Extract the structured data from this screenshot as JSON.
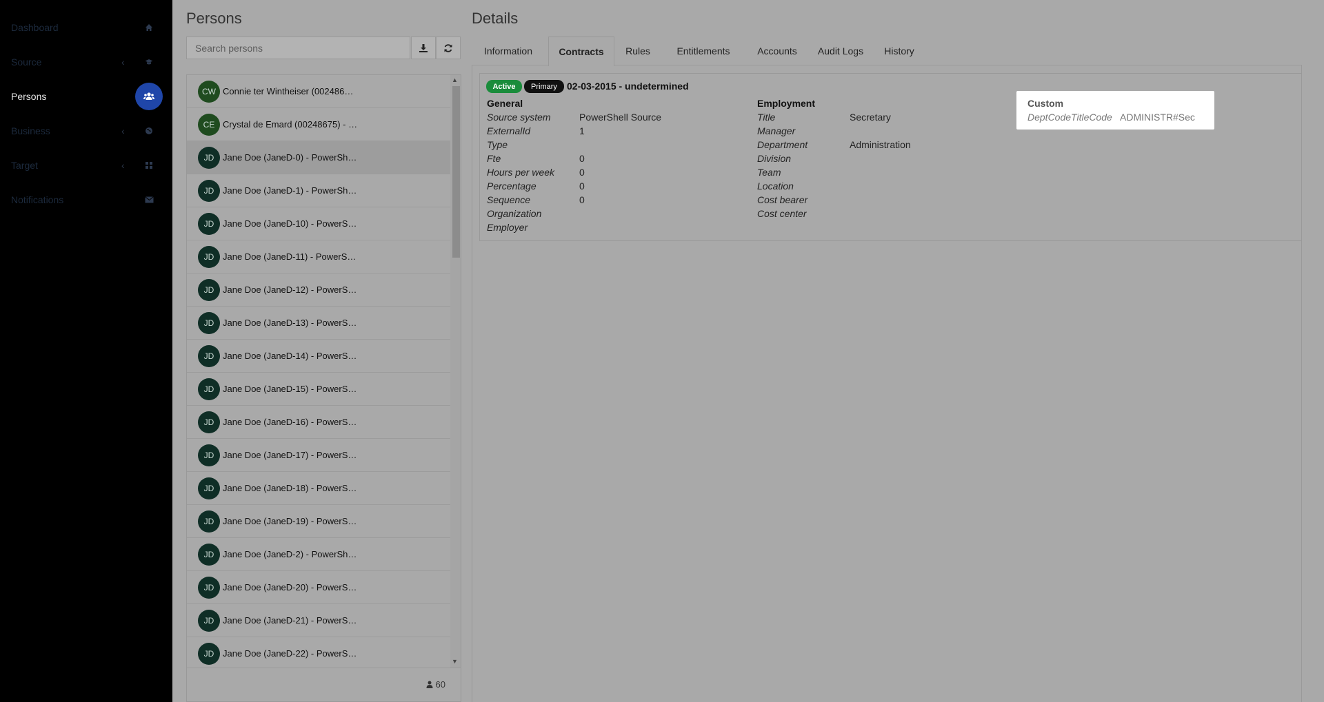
{
  "sidebar": {
    "items": [
      {
        "label": "Dashboard",
        "icon": "home-icon"
      },
      {
        "label": "Source",
        "icon": "graduation-cap-icon"
      },
      {
        "label": "Persons",
        "icon": "users-icon"
      },
      {
        "label": "Business",
        "icon": "globe-icon"
      },
      {
        "label": "Target",
        "icon": "grid-icon"
      },
      {
        "label": "Notifications",
        "icon": "envelope-icon"
      }
    ],
    "chevron": "‹"
  },
  "persons": {
    "title": "Persons",
    "search_placeholder": "Search persons",
    "rows": [
      {
        "initials": "CW",
        "name": "Connie ter Wintheiser (002486…"
      },
      {
        "initials": "CE",
        "name": "Crystal de Emard (00248675) - …"
      },
      {
        "initials": "JD",
        "name": "Jane Doe (JaneD-0) - PowerSh…"
      },
      {
        "initials": "JD",
        "name": "Jane Doe (JaneD-1) - PowerSh…"
      },
      {
        "initials": "JD",
        "name": "Jane Doe (JaneD-10) - PowerS…"
      },
      {
        "initials": "JD",
        "name": "Jane Doe (JaneD-11) - PowerS…"
      },
      {
        "initials": "JD",
        "name": "Jane Doe (JaneD-12) - PowerS…"
      },
      {
        "initials": "JD",
        "name": "Jane Doe (JaneD-13) - PowerS…"
      },
      {
        "initials": "JD",
        "name": "Jane Doe (JaneD-14) - PowerS…"
      },
      {
        "initials": "JD",
        "name": "Jane Doe (JaneD-15) - PowerS…"
      },
      {
        "initials": "JD",
        "name": "Jane Doe (JaneD-16) - PowerS…"
      },
      {
        "initials": "JD",
        "name": "Jane Doe (JaneD-17) - PowerS…"
      },
      {
        "initials": "JD",
        "name": "Jane Doe (JaneD-18) - PowerS…"
      },
      {
        "initials": "JD",
        "name": "Jane Doe (JaneD-19) - PowerS…"
      },
      {
        "initials": "JD",
        "name": "Jane Doe (JaneD-2) - PowerSh…"
      },
      {
        "initials": "JD",
        "name": "Jane Doe (JaneD-20) - PowerS…"
      },
      {
        "initials": "JD",
        "name": "Jane Doe (JaneD-21) - PowerS…"
      },
      {
        "initials": "JD",
        "name": "Jane Doe (JaneD-22) - PowerS…"
      }
    ],
    "count": "60"
  },
  "details": {
    "title": "Details",
    "tabs": [
      "Information",
      "Contracts",
      "Rules",
      "Entitlements",
      "Accounts",
      "Audit Logs",
      "History"
    ],
    "contract": {
      "status": "Active",
      "primary": "Primary",
      "period": "02-03-2015 - undetermined",
      "general": {
        "title": "General",
        "fields": [
          {
            "label": "Source system",
            "value": "PowerShell Source"
          },
          {
            "label": "ExternalId",
            "value": "1"
          },
          {
            "label": "Type",
            "value": ""
          },
          {
            "label": "Fte",
            "value": "0"
          },
          {
            "label": "Hours per week",
            "value": "0"
          },
          {
            "label": "Percentage",
            "value": "0"
          },
          {
            "label": "Sequence",
            "value": "0"
          },
          {
            "label": "Organization",
            "value": ""
          },
          {
            "label": "Employer",
            "value": ""
          }
        ]
      },
      "employment": {
        "title": "Employment",
        "fields": [
          {
            "label": "Title",
            "value": "Secretary"
          },
          {
            "label": "Manager",
            "value": ""
          },
          {
            "label": "Department",
            "value": "Administration"
          },
          {
            "label": "Division",
            "value": ""
          },
          {
            "label": "Team",
            "value": ""
          },
          {
            "label": "Location",
            "value": ""
          },
          {
            "label": "Cost bearer",
            "value": ""
          },
          {
            "label": "Cost center",
            "value": ""
          }
        ]
      },
      "custom": {
        "title": "Custom",
        "label": "DeptCodeTitleCode",
        "value": "ADMINISTR#Sec"
      }
    }
  },
  "colors": {
    "sidebar_bg": "#000000",
    "active_icon_bg": "#1f46a9",
    "badge_active": "#1a8c3b",
    "badge_primary": "#111111",
    "avatar_bg": "#0f2e26"
  }
}
